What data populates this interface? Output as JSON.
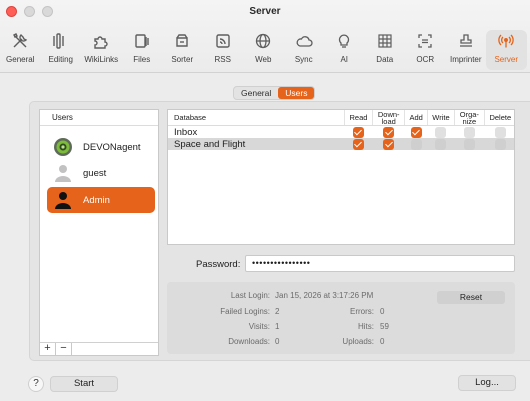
{
  "window": {
    "title": "Server"
  },
  "toolbar": [
    {
      "label": "General",
      "icon": "tools-icon"
    },
    {
      "label": "Editing",
      "icon": "editing-icon"
    },
    {
      "label": "WikiLinks",
      "icon": "puzzle-icon"
    },
    {
      "label": "Files",
      "icon": "files-icon"
    },
    {
      "label": "Sorter",
      "icon": "sorter-icon"
    },
    {
      "label": "RSS",
      "icon": "rss-icon"
    },
    {
      "label": "Web",
      "icon": "globe-icon"
    },
    {
      "label": "Sync",
      "icon": "cloud-icon"
    },
    {
      "label": "AI",
      "icon": "lightbulb-icon"
    },
    {
      "label": "Data",
      "icon": "table-icon"
    },
    {
      "label": "OCR",
      "icon": "ocr-icon"
    },
    {
      "label": "Imprinter",
      "icon": "stamp-icon"
    },
    {
      "label": "Server",
      "icon": "broadcast-icon",
      "selected": true
    }
  ],
  "tabs": {
    "general": "General",
    "users": "Users"
  },
  "users": {
    "header": "Users",
    "items": [
      {
        "name": "DEVONagent"
      },
      {
        "name": "guest"
      },
      {
        "name": "Admin",
        "selected": true
      }
    ],
    "add": "+",
    "remove": "−"
  },
  "db": {
    "headers": {
      "database": "Database",
      "read": "Read",
      "download": "Down-\nload",
      "add": "Add",
      "write": "Write",
      "organize": "Orga-\nnize",
      "delete": "Delete"
    },
    "rows": [
      {
        "name": "Inbox",
        "read": true,
        "download": true,
        "add": true,
        "write": false,
        "organize": false,
        "delete": false
      },
      {
        "name": "Space and Flight",
        "read": true,
        "download": true,
        "add": false,
        "write": false,
        "organize": false,
        "delete": false,
        "selected": true
      }
    ]
  },
  "password": {
    "label": "Password:",
    "value": "••••••••••••••••"
  },
  "stats": {
    "last_login_label": "Last Login:",
    "last_login": "Jan 15, 2026 at 3:17:26 PM",
    "failed_logins_label": "Failed Logins:",
    "failed_logins": "2",
    "errors_label": "Errors:",
    "errors": "0",
    "visits_label": "Visits:",
    "visits": "1",
    "hits_label": "Hits:",
    "hits": "59",
    "downloads_label": "Downloads:",
    "downloads": "0",
    "uploads_label": "Uploads:",
    "uploads": "0"
  },
  "buttons": {
    "reset": "Reset",
    "help": "?",
    "start": "Start",
    "log": "Log..."
  },
  "colors": {
    "accent": "#e5631a"
  }
}
